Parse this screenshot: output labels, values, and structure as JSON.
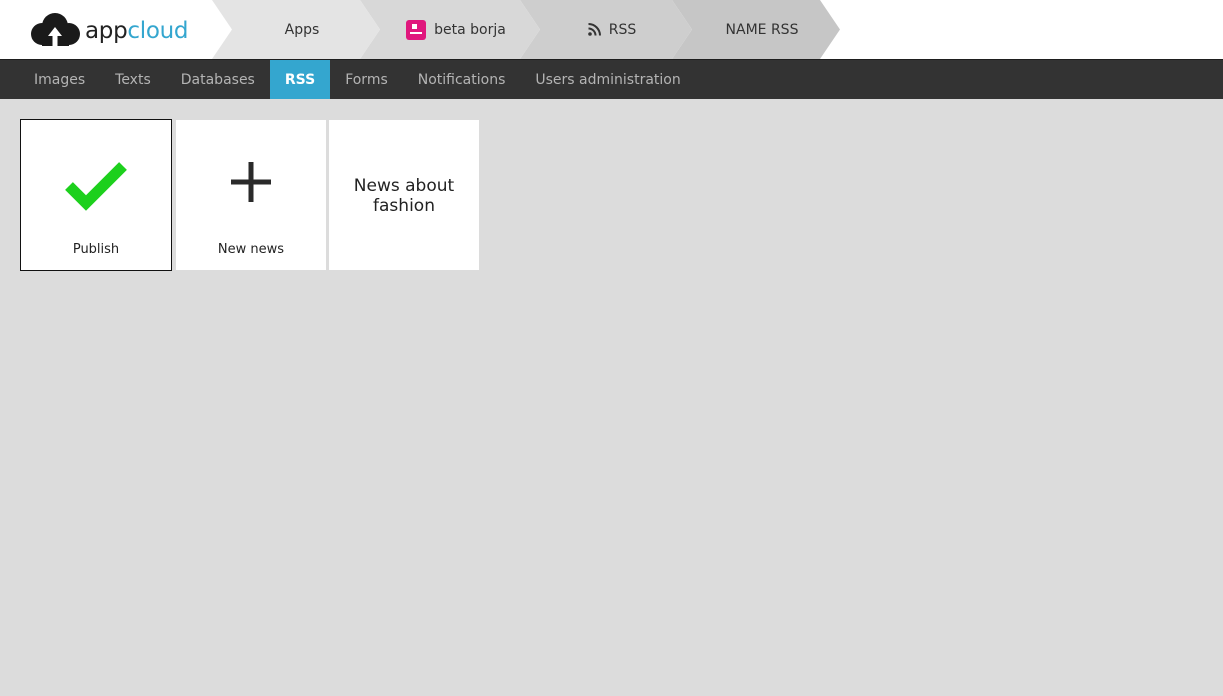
{
  "brand": {
    "name_part1": "app",
    "name_part2": "cloud",
    "accent_color": "#34a6cf"
  },
  "breadcrumbs": [
    {
      "label": "Apps",
      "icon": null
    },
    {
      "label": "beta borja",
      "icon": "app-badge-icon",
      "icon_color": "#e0177d"
    },
    {
      "label": "RSS",
      "icon": "rss-icon"
    },
    {
      "label": "NAME RSS",
      "icon": null
    }
  ],
  "nav": {
    "items": [
      {
        "label": "Images",
        "active": false
      },
      {
        "label": "Texts",
        "active": false
      },
      {
        "label": "Databases",
        "active": false
      },
      {
        "label": "RSS",
        "active": true
      },
      {
        "label": "Forms",
        "active": false
      },
      {
        "label": "Notifications",
        "active": false
      },
      {
        "label": "Users administration",
        "active": false
      }
    ],
    "active_color": "#34a6cf"
  },
  "tiles": [
    {
      "label": "Publish",
      "icon": "checkmark-icon",
      "icon_color": "#1dd01d",
      "selected": true
    },
    {
      "label": "New news",
      "icon": "plus-icon"
    },
    {
      "title": "News about fashion"
    }
  ]
}
